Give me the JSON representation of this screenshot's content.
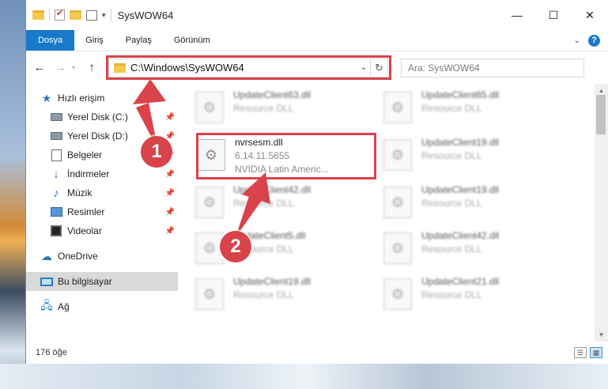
{
  "window": {
    "title": "SysWOW64",
    "minimize": "—",
    "maximize": "☐",
    "close": "✕"
  },
  "ribbon": {
    "tabs": [
      "Dosya",
      "Giriş",
      "Paylaş",
      "Görünüm"
    ],
    "help": "?"
  },
  "navigation": {
    "back": "←",
    "forward": "→",
    "up": "↑",
    "address": "C:\\Windows\\SysWOW64",
    "search_placeholder": "Ara: SysWOW64"
  },
  "sidebar": {
    "items": [
      {
        "label": "Hızlı erişim",
        "icon": "star-icon"
      },
      {
        "label": "Yerel Disk (C:)",
        "icon": "drive-icon",
        "pinned": true
      },
      {
        "label": "Yerel Disk (D:)",
        "icon": "drive-icon",
        "pinned": true
      },
      {
        "label": "Belgeler",
        "icon": "documents-icon",
        "pinned": true
      },
      {
        "label": "İndirmeler",
        "icon": "download-icon",
        "pinned": true
      },
      {
        "label": "Müzik",
        "icon": "music-icon",
        "pinned": true
      },
      {
        "label": "Resimler",
        "icon": "pictures-icon",
        "pinned": true
      },
      {
        "label": "Videolar",
        "icon": "videos-icon",
        "pinned": true
      },
      {
        "label": "OneDrive",
        "icon": "cloud-icon"
      },
      {
        "label": "Bu bilgisayar",
        "icon": "computer-icon",
        "selected": true
      },
      {
        "label": "Ağ",
        "icon": "network-icon"
      }
    ]
  },
  "files": [
    {
      "name": "UpdateClient63.dll",
      "type": "Resource DLL"
    },
    {
      "name": "UpdateClient65.dll",
      "type": "Resource DLL"
    },
    {
      "name": "nvrsesm.dll",
      "version": "6.14.11.5655",
      "company": "NVIDIA Latin Americ..."
    },
    {
      "name": "UpdateClient19.dll",
      "type": "Resource DLL"
    },
    {
      "name": "UpdateClient42.dll",
      "type": "Resource DLL"
    },
    {
      "name": "UpdateClient19.dll",
      "type": "Resource DLL"
    },
    {
      "name": "UpdateClient5.dll",
      "type": "Resource DLL"
    },
    {
      "name": "UpdateClient42.dll",
      "type": "Resource DLL"
    },
    {
      "name": "UpdateClient19.dll",
      "type": "Resource DLL"
    },
    {
      "name": "UpdateClient21.dll",
      "type": "Resource DLL"
    }
  ],
  "status": {
    "item_count": "176 öğe"
  },
  "callouts": [
    "1",
    "2"
  ],
  "colors": {
    "accent": "#1979ca",
    "highlight": "#d9434a"
  }
}
